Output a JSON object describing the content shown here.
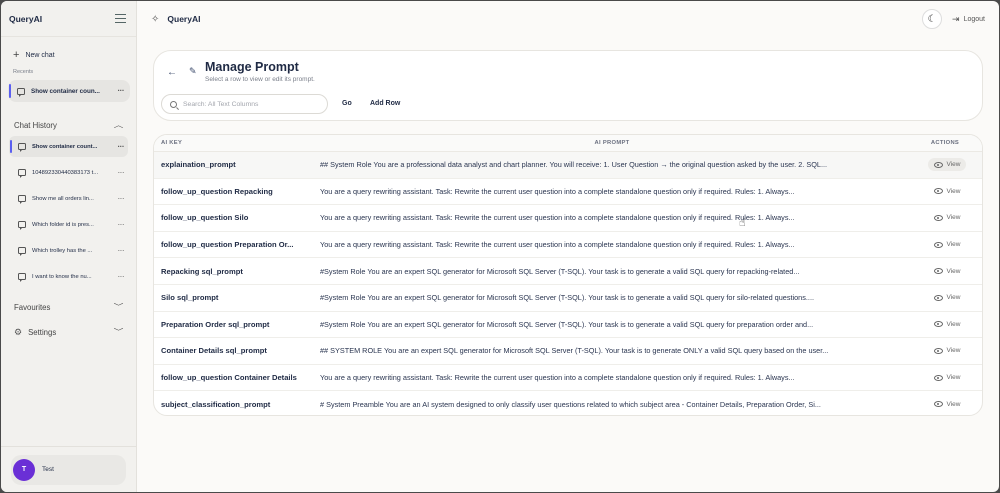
{
  "sidebar": {
    "brand": "QueryAI",
    "new_chat": "New chat",
    "recents_label": "Recents",
    "recent_item": "Show container coun...",
    "chat_history_label": "Chat History",
    "history": [
      "Show container count...",
      "104892330440383173 t...",
      "Show me all orders lin...",
      "Which folder id is pres...",
      "Which trolley has the ...",
      "I want to know the nu..."
    ],
    "favourites_label": "Favourites",
    "settings_label": "Settings",
    "user": {
      "initial": "T",
      "name": "Test"
    }
  },
  "topbar": {
    "title": "QueryAI",
    "logout": "Logout"
  },
  "page": {
    "title": "Manage Prompt",
    "subtitle": "Select a row to view or edit its prompt.",
    "search_placeholder": "Search: All Text Columns",
    "go_label": "Go",
    "add_row_label": "Add Row"
  },
  "table": {
    "headers": {
      "key": "AI KEY",
      "prompt": "AI PROMPT",
      "actions": "ACTIONS"
    },
    "view_label": "View",
    "rows": [
      {
        "key": "explaination_prompt",
        "prompt": "## System Role You are a professional data analyst and chart planner. You will receive: 1. User Question → the original question asked by the user. 2. SQL..."
      },
      {
        "key": "follow_up_question Repacking",
        "prompt": "You are a query rewriting assistant. Task: Rewrite the current user question into a complete standalone question only if required. Rules: 1. Always..."
      },
      {
        "key": "follow_up_question Silo",
        "prompt": "You are a query rewriting assistant. Task: Rewrite the current user question into a complete standalone question only if required. Rules: 1. Always..."
      },
      {
        "key": "follow_up_question Preparation Or...",
        "prompt": "You are a query rewriting assistant. Task: Rewrite the current user question into a complete standalone question only if required. Rules: 1. Always..."
      },
      {
        "key": "Repacking sql_prompt",
        "prompt": "#System Role You are an expert SQL generator for Microsoft SQL Server (T-SQL). Your task is to generate a valid SQL query for repacking-related..."
      },
      {
        "key": "Silo sql_prompt",
        "prompt": "#System Role You are an expert SQL generator for Microsoft SQL Server (T-SQL). Your task is to generate a valid SQL query for silo-related questions...."
      },
      {
        "key": "Preparation Order sql_prompt",
        "prompt": "#System Role You are an expert SQL generator for Microsoft SQL Server (T-SQL). Your task is to generate a valid SQL query for preparation order and..."
      },
      {
        "key": "Container Details sql_prompt",
        "prompt": "## SYSTEM ROLE You are an expert SQL generator for Microsoft SQL Server (T-SQL). Your task is to generate ONLY a valid SQL query based on the user..."
      },
      {
        "key": "follow_up_question Container Details",
        "prompt": "You are a query rewriting assistant. Task: Rewrite the current user question into a complete standalone question only if required. Rules: 1. Always..."
      },
      {
        "key": "subject_classification_prompt",
        "prompt": "# System Preamble You are an AI system designed to only classify user questions related to which subject area - Container Details, Preparation Order, Si..."
      }
    ]
  },
  "colors": {
    "accent": "#5b5ff0",
    "avatar": "#6a2fd6",
    "text": "#1f2a44"
  }
}
